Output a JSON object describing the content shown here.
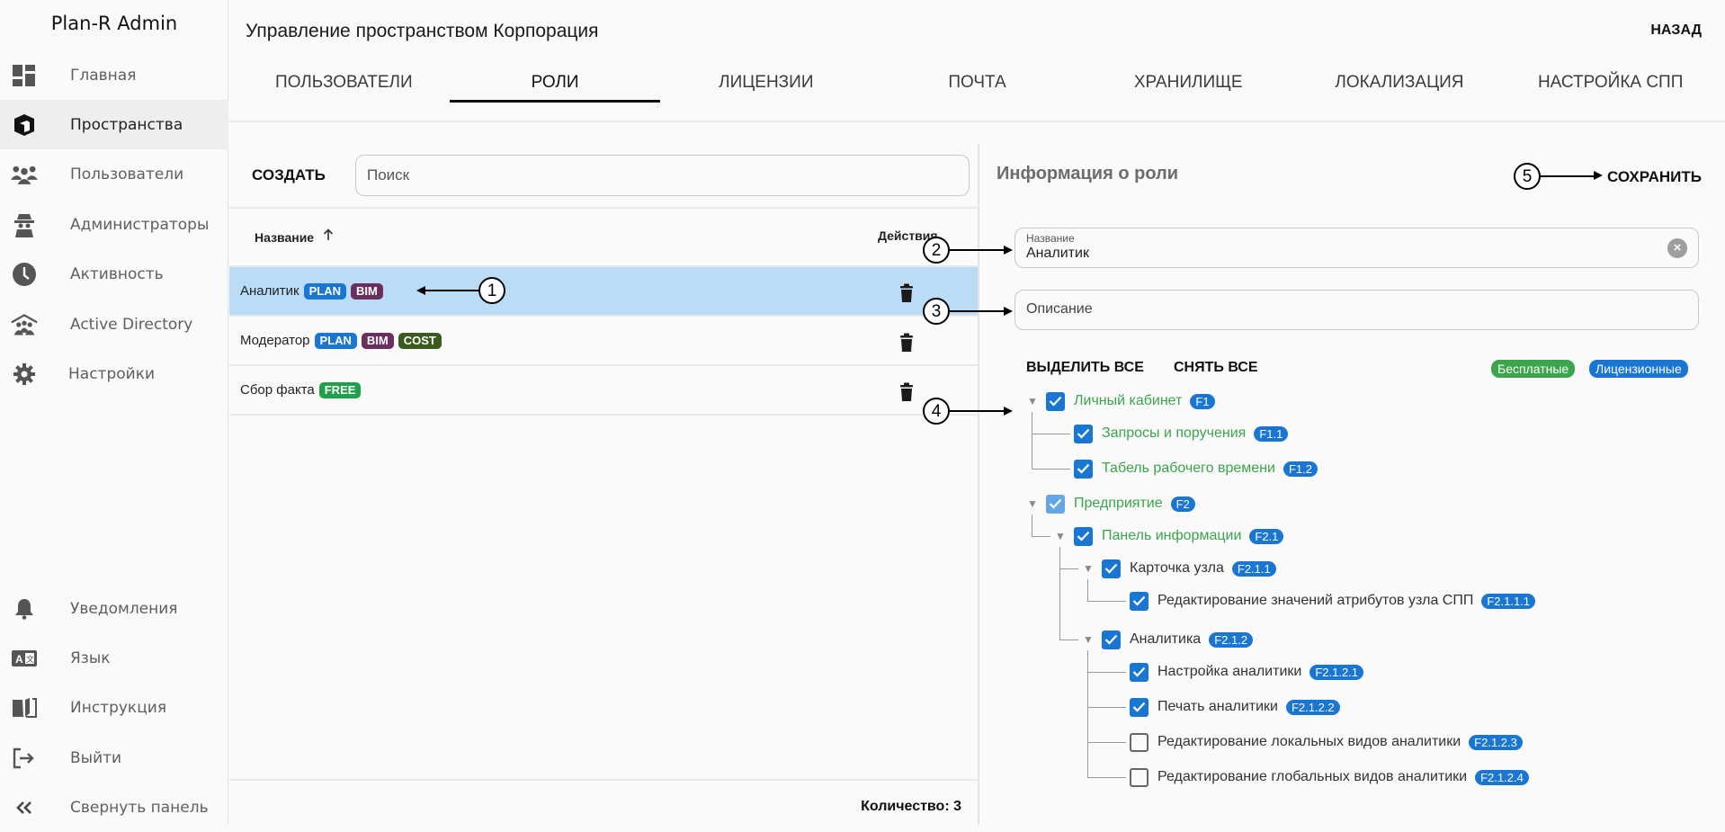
{
  "app": {
    "title": "Plan-R Admin"
  },
  "sidebar": {
    "items": [
      {
        "label": "Главная",
        "icon": "dashboard-icon"
      },
      {
        "label": "Пространства",
        "icon": "cube-icon",
        "active": true
      },
      {
        "label": "Пользователи",
        "icon": "users-icon"
      },
      {
        "label": "Администраторы",
        "icon": "admin-spy-icon"
      },
      {
        "label": "Активность",
        "icon": "clock-icon"
      },
      {
        "label": "Active Directory",
        "icon": "house-users-icon"
      },
      {
        "label": "Настройки",
        "icon": "gear-icon"
      }
    ],
    "bottom_items": [
      {
        "label": "Уведомления",
        "icon": "bell-icon"
      },
      {
        "label": "Язык",
        "icon": "language-icon"
      },
      {
        "label": "Инструкция",
        "icon": "book-icon"
      },
      {
        "label": "Выйти",
        "icon": "logout-icon"
      },
      {
        "label": "Свернуть панель",
        "icon": "collapse-icon"
      }
    ]
  },
  "header": {
    "title": "Управление пространством Корпорация",
    "back_label": "НАЗАД",
    "tabs": [
      {
        "label": "ПОЛЬЗОВАТЕЛИ"
      },
      {
        "label": "РОЛИ",
        "active": true
      },
      {
        "label": "ЛИЦЕНЗИИ"
      },
      {
        "label": "ПОЧТА"
      },
      {
        "label": "ХРАНИЛИЩЕ"
      },
      {
        "label": "ЛОКАЛИЗАЦИЯ"
      },
      {
        "label": "НАСТРОЙКА СПП"
      }
    ]
  },
  "roles": {
    "create_label": "СОЗДАТЬ",
    "search_placeholder": "Поиск",
    "columns": {
      "name": "Название",
      "actions": "Действия"
    },
    "rows": [
      {
        "name": "Аналитик",
        "selected": true,
        "badges": [
          {
            "text": "PLAN",
            "color": "#1976d2"
          },
          {
            "text": "BIM",
            "color": "#6a2f5e"
          }
        ]
      },
      {
        "name": "Модератор",
        "badges": [
          {
            "text": "PLAN",
            "color": "#1976d2"
          },
          {
            "text": "BIM",
            "color": "#6a2f5e"
          },
          {
            "text": "COST",
            "color": "#3b5a1e"
          }
        ]
      },
      {
        "name": "Сбор факта",
        "badges": [
          {
            "text": "FREE",
            "color": "#1fa04a"
          }
        ]
      }
    ],
    "count_label": "Количество: 3"
  },
  "role_info": {
    "title": "Информация о роли",
    "save_label": "СОХРАНИТЬ",
    "name_field": {
      "label": "Название",
      "value": "Аналитик"
    },
    "description_field": {
      "placeholder": "Описание",
      "value": ""
    },
    "select_all_label": "ВЫДЕЛИТЬ ВСЕ",
    "deselect_all_label": "СНЯТЬ ВСЕ",
    "legend": {
      "free": "Бесплатные",
      "free_color": "#3aa54a",
      "licensed": "Лицензионные",
      "licensed_color": "#1976d2"
    },
    "tree": [
      {
        "label": "Личный кабинет",
        "code": "F1",
        "level": 0,
        "state": "on",
        "expandable": true,
        "free": true
      },
      {
        "label": "Запросы и поручения",
        "code": "F1.1",
        "level": 1,
        "state": "on",
        "free": true
      },
      {
        "label": "Табель рабочего времени",
        "code": "F1.2",
        "level": 1,
        "state": "on",
        "free": true
      },
      {
        "label": "Предприятие",
        "code": "F2",
        "level": 0,
        "state": "partial",
        "expandable": true,
        "free": true
      },
      {
        "label": "Панель информации",
        "code": "F2.1",
        "level": 1,
        "state": "on",
        "expandable": true,
        "free": true
      },
      {
        "label": "Карточка узла",
        "code": "F2.1.1",
        "level": 2,
        "state": "on",
        "expandable": true
      },
      {
        "label": "Редактирование значений атрибутов узла СПП",
        "code": "F2.1.1.1",
        "level": 3,
        "state": "on"
      },
      {
        "label": "Аналитика",
        "code": "F2.1.2",
        "level": 2,
        "state": "on",
        "expandable": true
      },
      {
        "label": "Настройка аналитики",
        "code": "F2.1.2.1",
        "level": 3,
        "state": "on"
      },
      {
        "label": "Печать аналитики",
        "code": "F2.1.2.2",
        "level": 3,
        "state": "on"
      },
      {
        "label": "Редактирование локальных видов аналитики",
        "code": "F2.1.2.3",
        "level": 3,
        "state": "off"
      },
      {
        "label": "Редактирование глобальных видов аналитики",
        "code": "F2.1.2.4",
        "level": 3,
        "state": "off"
      }
    ]
  },
  "callouts": [
    "1",
    "2",
    "3",
    "4",
    "5"
  ]
}
